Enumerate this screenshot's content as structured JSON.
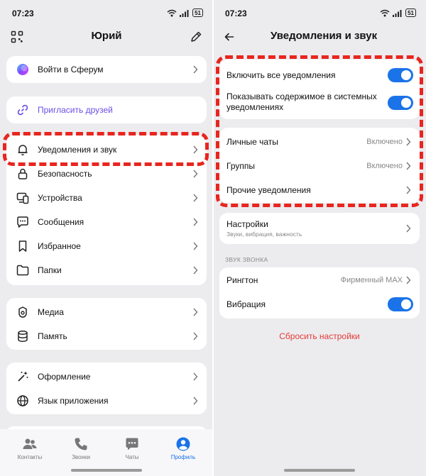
{
  "status": {
    "time": "07:23",
    "battery": "51"
  },
  "left": {
    "title": "Юрий",
    "sferum": "Войти в Сферум",
    "invite": "Пригласить друзей",
    "menu": [
      "Уведомления и звук",
      "Безопасность",
      "Устройства",
      "Сообщения",
      "Избранное",
      "Папки",
      "Медиа",
      "Память",
      "Оформление",
      "Язык приложения"
    ],
    "nav": [
      "Контакты",
      "Звонки",
      "Чаты",
      "Профиль"
    ]
  },
  "right": {
    "title": "Уведомления и звук",
    "enable_all": "Включить все уведомления",
    "show_content_1": "Показывать содержимое в системных",
    "show_content_2": "уведомлениях",
    "personal_chats": "Личные чаты",
    "personal_chats_value": "Включено",
    "groups": "Группы",
    "groups_value": "Включено",
    "other": "Прочие уведомления",
    "settings": "Настройки",
    "settings_sub": "Звуки, вибрация, важность",
    "ring_section": "ЗВУК ЗВОНКА",
    "ringtone": "Рингтон",
    "ringtone_value": "Фирменный MAX",
    "vibration": "Вибрация",
    "reset": "Сбросить настройки"
  },
  "colors": {
    "accent": "#1a73e8",
    "highlight": "#e8251f",
    "danger": "#e53935",
    "invite": "#6b4ee6"
  }
}
